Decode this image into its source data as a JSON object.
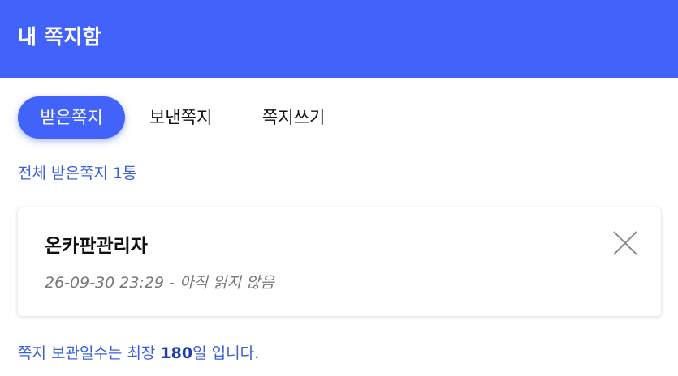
{
  "header": {
    "title": "내 쪽지함"
  },
  "tabs": [
    {
      "label": "받은쪽지",
      "active": true
    },
    {
      "label": "보낸쪽지",
      "active": false
    },
    {
      "label": "쪽지쓰기",
      "active": false
    }
  ],
  "inbox": {
    "count_text": "전체 받은쪽지 1통"
  },
  "messages": [
    {
      "sender": "온카판관리자",
      "meta": "26-09-30 23:29 - 아직 읽지 않음",
      "close_icon": "close-icon"
    }
  ],
  "notice": {
    "prefix": "쪽지 보관일수는 최장 ",
    "days": "180",
    "suffix": "일 입니다."
  },
  "colors": {
    "brand": "#4163f9",
    "link_text": "#3a5fd9"
  }
}
